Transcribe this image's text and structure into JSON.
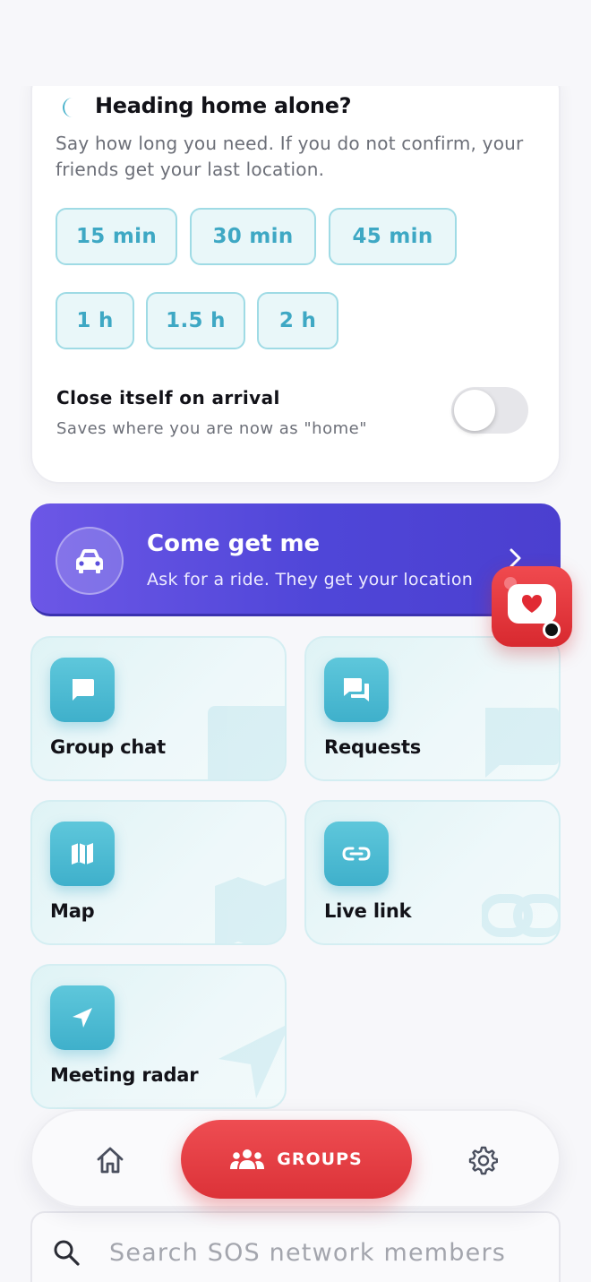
{
  "home_alone": {
    "title": "Heading home alone?",
    "description": "Say how long you need. If you do not confirm, your friends get your last location.",
    "durations": [
      "15 min",
      "30 min",
      "45 min",
      "1 h",
      "1.5 h",
      "2 h"
    ],
    "arrival_title": "Close itself on arrival",
    "arrival_subtitle": "Saves where you are now as \"home\"",
    "arrival_enabled": false
  },
  "ride_banner": {
    "title": "Come get me",
    "subtitle": "Ask for a ride. They get your location"
  },
  "tiles": [
    {
      "label": "Group chat",
      "icon": "chat-icon"
    },
    {
      "label": "Requests",
      "icon": "requests-icon"
    },
    {
      "label": "Map",
      "icon": "map-icon"
    },
    {
      "label": "Live link",
      "icon": "link-icon"
    },
    {
      "label": "Meeting radar",
      "icon": "navigation-arrow-icon"
    }
  ],
  "bottom_nav": {
    "active_label": "GROUPS",
    "items": [
      "home-icon",
      "groups-icon",
      "settings-icon"
    ]
  },
  "search": {
    "placeholder": "Search SOS network members"
  },
  "colors": {
    "accent_teal": "#3fb0cb",
    "banner_purple": "#4f46d8",
    "sos_red": "#dc3238"
  }
}
